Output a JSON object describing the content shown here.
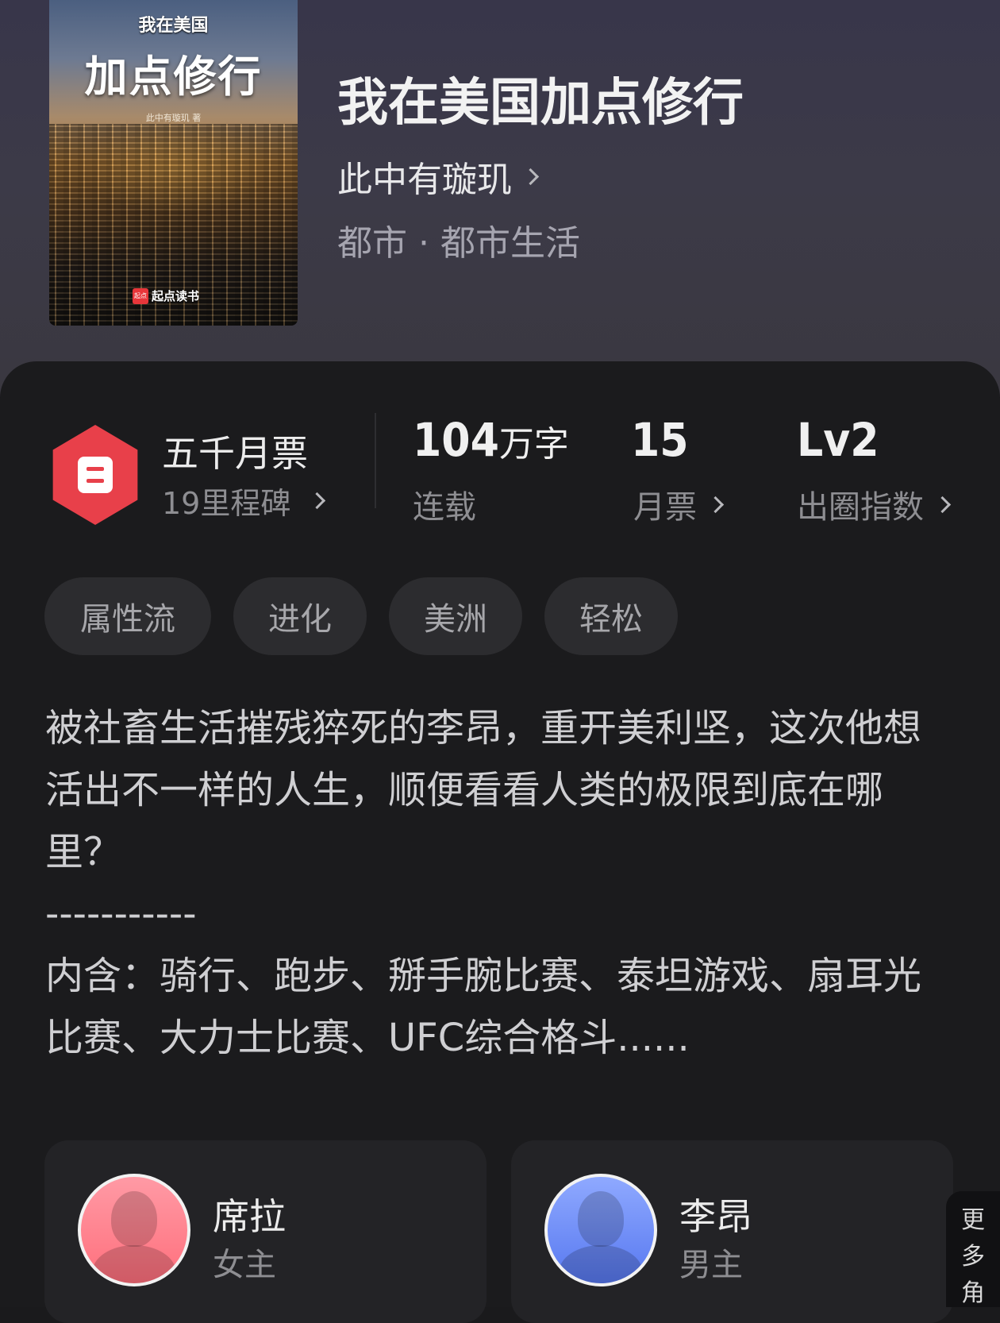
{
  "book": {
    "cover": {
      "subtitle": "我在美国",
      "title": "加点修行",
      "author": "此中有璇玑 著",
      "brand": "起点读书",
      "brand_logo": "起点"
    },
    "title": "我在美国加点修行",
    "author": "此中有璇玑",
    "category": "都市 · 都市生活"
  },
  "stats": {
    "milestone": {
      "title": "五千月票",
      "subtitle": "19里程碑",
      "icon": "ticket-icon",
      "badge_color": "#e8404a"
    },
    "word_count": {
      "value": "104",
      "unit": "万字",
      "label": "连载"
    },
    "monthly_votes": {
      "value": "15",
      "label": "月票"
    },
    "breakout_index": {
      "value": "Lv2",
      "label": "出圈指数"
    }
  },
  "tags": [
    "属性流",
    "进化",
    "美洲",
    "轻松"
  ],
  "synopsis": {
    "line1": "被社畜生活摧残猝死的李昂，重开美利坚，这次他想活出不一样的人生，顺便看看人类的极限到底在哪里？",
    "divider": "-----------",
    "line2": "内含：骑行、跑步、掰手腕比赛、泰坦游戏、扇耳光比赛、大力士比赛、UFC综合格斗......"
  },
  "characters": [
    {
      "name": "席拉",
      "role": "女主",
      "avatar_color": "#ff7f8c"
    },
    {
      "name": "李昂",
      "role": "男主",
      "avatar_color": "#6b88f5"
    }
  ],
  "more_characters": [
    "更",
    "多",
    "角"
  ]
}
